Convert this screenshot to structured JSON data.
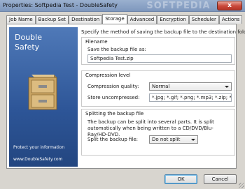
{
  "window": {
    "title": "Properties: Softpedia Test - DoubleSafety",
    "watermark": "SOFTPEDIA",
    "close_label": "x"
  },
  "tabs": [
    {
      "label": "Job Name",
      "active": false
    },
    {
      "label": "Backup Set",
      "active": false
    },
    {
      "label": "Destination",
      "active": false
    },
    {
      "label": "Storage",
      "active": true
    },
    {
      "label": "Advanced",
      "active": false
    },
    {
      "label": "Encryption",
      "active": false
    },
    {
      "label": "Scheduler",
      "active": false
    },
    {
      "label": "Actions",
      "active": false
    }
  ],
  "banner": {
    "brand_line1": "Double",
    "brand_line2": "Safety",
    "tagline": "Protect your information",
    "website": "www.DoubleSafety.com",
    "color": "#2d5597"
  },
  "storage": {
    "intro": "Specify the method of saving the backup file to the destination folder.",
    "filename_group": "Filename",
    "save_label": "Save the backup file as:",
    "save_value": "Softpedia Test.zip",
    "compression_group": "Compression level",
    "quality_label": "Compression quality:",
    "quality_value": "Normal",
    "store_label": "Store uncompressed:",
    "store_value": "*.jpg; *.gif; *.png; *.mp3; *.zip; *.rar; *",
    "split_group": "Splitting the backup file",
    "split_desc": "The backup can be split into several parts. It is split automatically when being written to a CD/DVD/Blu-Ray/HD-DVD.",
    "split_label": "Split the backup file:",
    "split_value": "Do not split"
  },
  "buttons": {
    "ok": "OK",
    "cancel": "Cancel"
  }
}
